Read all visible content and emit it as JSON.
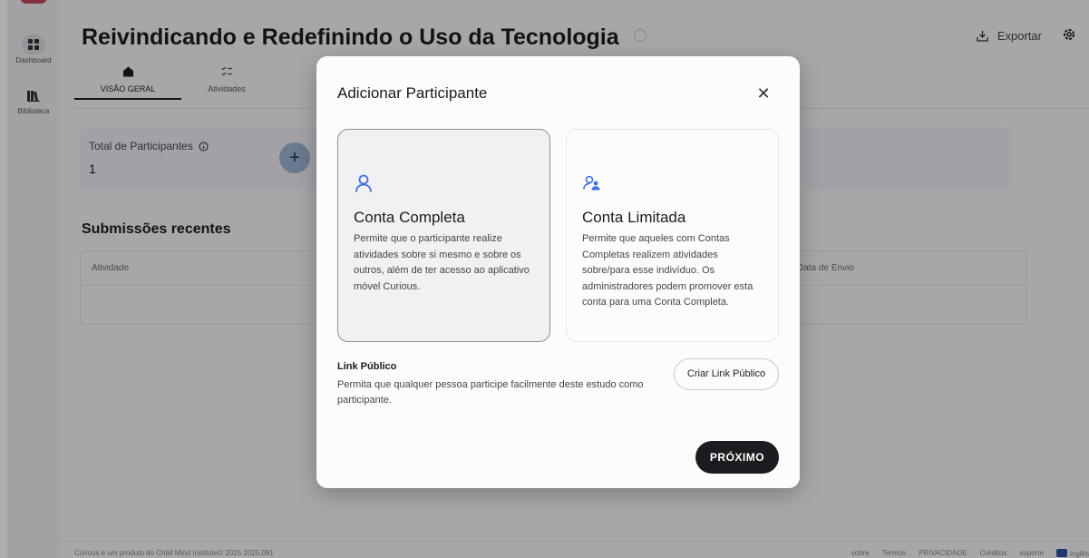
{
  "sidebar": {
    "items": [
      {
        "label": "Dashboard",
        "icon": "grid-icon"
      },
      {
        "label": "Biblioteca",
        "icon": "library-icon"
      }
    ]
  },
  "header": {
    "title": "Reivindicando e Redefinindo o Uso da Tecnologia",
    "export_label": "Exportar"
  },
  "tabs": [
    {
      "label": "VISÃO GERAL",
      "icon": "home-icon",
      "active": true
    },
    {
      "label": "Atividades",
      "icon": "checklist-icon",
      "active": false
    }
  ],
  "stats": {
    "total_label": "Total de Participantes",
    "total_value": "1"
  },
  "submissions": {
    "title": "Submissões recentes",
    "columns": [
      "Atividade",
      "Data de Envio"
    ]
  },
  "footer": {
    "left": "Curious é um produto do Child Mind Institute© 2025 2025.091",
    "links": [
      "sobre",
      "Termos",
      "PRIVACIDADE",
      "Créditos",
      "suporte"
    ],
    "language": "inglês"
  },
  "modal": {
    "title": "Adicionar Participante",
    "close_icon": "close-icon",
    "options": [
      {
        "name": "Conta Completa",
        "icon": "person-icon",
        "description": "Permite que o participante realize atividades sobre si mesmo e sobre os outros, além de ter acesso ao aplicativo móvel Curious.",
        "selected": true
      },
      {
        "name": "Conta Limitada",
        "icon": "people-icon",
        "description": "Permite que aqueles com Contas Completas realizem atividades sobre/para esse indivíduo. Os administradores podem promover esta conta para uma Conta Completa.",
        "selected": false
      }
    ],
    "public_link": {
      "title": "Link Público",
      "description": "Permita que qualquer pessoa participe facilmente deste estudo como participante.",
      "button_label": "Criar Link Público"
    },
    "next_label": "PRÓXIMO"
  },
  "colors": {
    "accent": "#3f6fe0",
    "primary_button": "#1c1b1f",
    "overlay": "rgba(0,0,0,0.32)"
  }
}
